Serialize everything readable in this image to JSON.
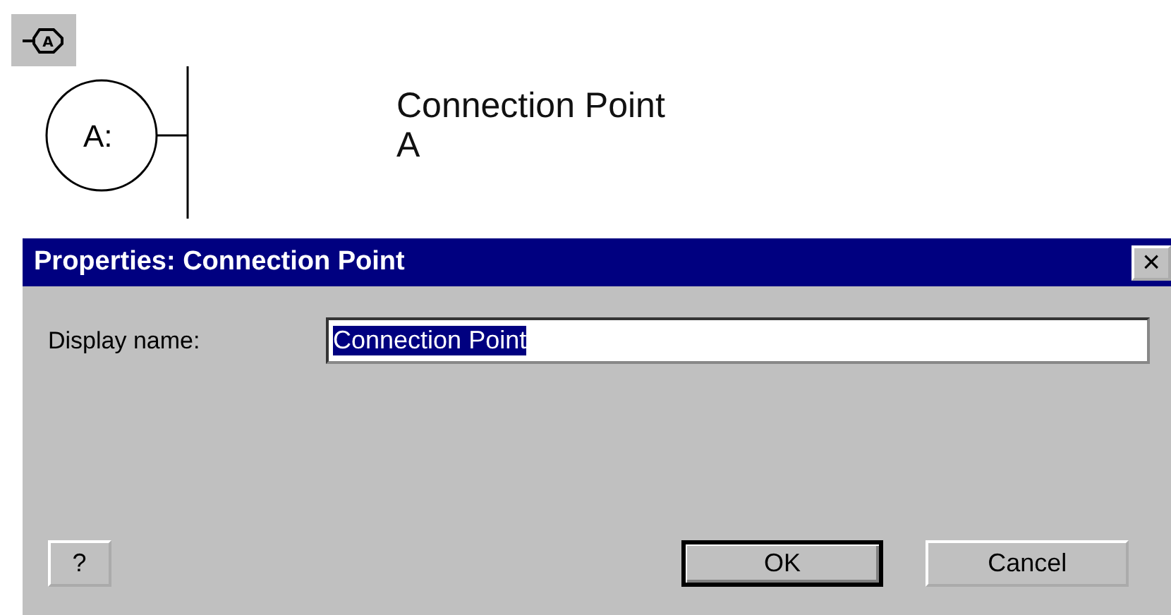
{
  "toolbar": {
    "tool_selected": true,
    "tool_glyph": "A"
  },
  "canvas": {
    "symbol_label": "A:",
    "caption": "Connection Point",
    "caption_sub": "A"
  },
  "dialog": {
    "title": "Properties: Connection Point",
    "close": "×",
    "field": {
      "label": "Display name:",
      "value": "Connection Point",
      "value_selected": true
    },
    "buttons": [
      {
        "label": "?",
        "kind": "help",
        "default": false
      },
      {
        "label": "OK",
        "kind": "action",
        "default": true
      },
      {
        "label": "Cancel",
        "kind": "action",
        "default": false
      }
    ]
  }
}
